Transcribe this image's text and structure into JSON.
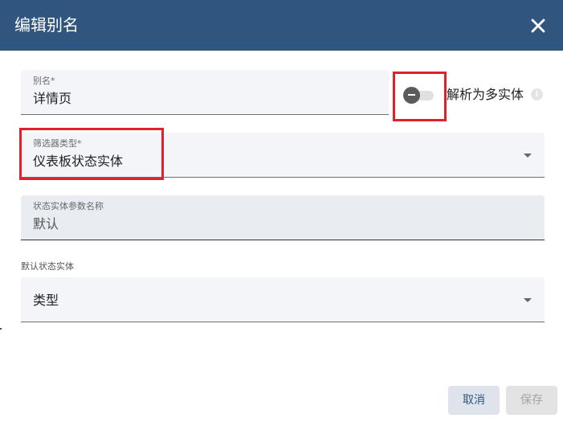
{
  "dialog": {
    "title": "编辑别名",
    "colors": {
      "header": "#305680",
      "highlight": "#e0202a",
      "field_bg": "#f4f5f8"
    }
  },
  "alias": {
    "label": "别名*",
    "value": "详情页"
  },
  "resolve_multiple": {
    "label": "解析为多实体",
    "enabled": false,
    "info_icon": "info-icon"
  },
  "filter_type": {
    "label": "筛选器类型*",
    "value": "仪表板状态实体"
  },
  "state_param": {
    "label": "状态实体参数名称",
    "value": "默认"
  },
  "default_state_entity": {
    "section_label": "默认状态实体",
    "type_value": "类型"
  },
  "actions": {
    "cancel_label": "取消",
    "save_label": "保存"
  }
}
